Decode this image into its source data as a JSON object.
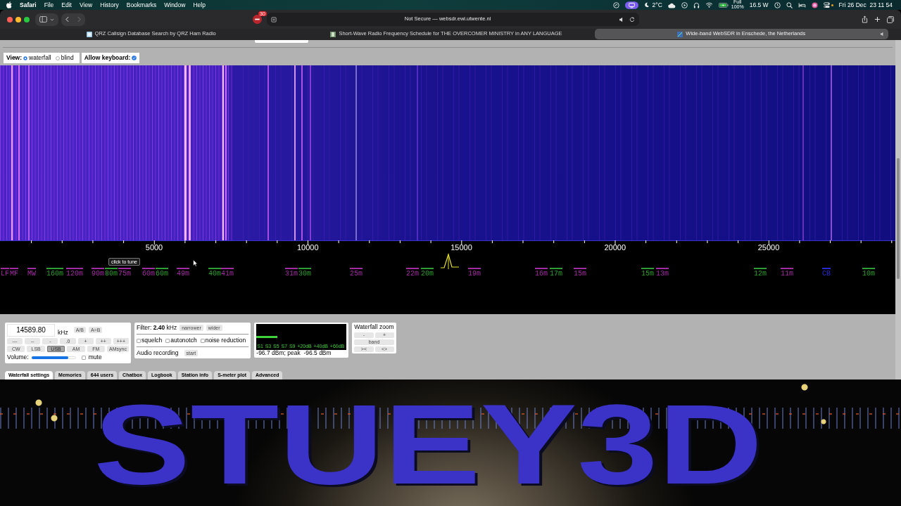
{
  "menu_bar": {
    "app": "Safari",
    "menus": [
      "File",
      "Edit",
      "View",
      "History",
      "Bookmarks",
      "Window",
      "Help"
    ],
    "temperature": "2°C",
    "battery_text": [
      "Full",
      "100%"
    ],
    "power": "16.5 W",
    "clock": "Fri 26 Dec  23 11 54"
  },
  "browser": {
    "extension_badge": "30",
    "address": "Not Secure — websdr.ewi.utwente.nl",
    "tabs": [
      {
        "title": "QRZ Callsign Database Search by QRZ Ham Radio",
        "selected": false,
        "audio": false
      },
      {
        "title": "Short-Wave Radio Frequency Schedule for THE OVERCOMER MINISTRY in ANY LANGUAGE",
        "selected": false,
        "audio": false
      },
      {
        "title": "Wide-band WebSDR in Enschede, the Netherlands",
        "selected": true,
        "audio": true
      }
    ]
  },
  "view_bar": {
    "label": "View:",
    "options": [
      {
        "label": "waterfall",
        "selected": true
      },
      {
        "label": "blind",
        "selected": false
      }
    ],
    "keyboard": {
      "label": "Allow keyboard:",
      "checked": true
    }
  },
  "frequency_scale": {
    "labels": [
      "5000",
      "10000",
      "15000",
      "20000",
      "25000"
    ],
    "tooltip": "click to tune",
    "bands": [
      {
        "label": "LF",
        "color": "#a12ca1"
      },
      {
        "label": "MF",
        "color": "#a12ca1"
      },
      {
        "label": "MW",
        "color": "#a12ca1"
      },
      {
        "label": "160m",
        "color": "#2f9f2f"
      },
      {
        "label": "120m",
        "color": "#a12ca1"
      },
      {
        "label": "90m",
        "color": "#a12ca1"
      },
      {
        "label": "80m",
        "color": "#2f9f2f"
      },
      {
        "label": "75m",
        "color": "#a12ca1"
      },
      {
        "label": "60m",
        "color": "#a12ca1"
      },
      {
        "label": "60m",
        "color": "#2f9f2f"
      },
      {
        "label": "49m",
        "color": "#a12ca1"
      },
      {
        "label": "40m",
        "color": "#2f9f2f"
      },
      {
        "label": "41m",
        "color": "#a12ca1"
      },
      {
        "label": "31m",
        "color": "#a12ca1"
      },
      {
        "label": "30m",
        "color": "#2f9f2f"
      },
      {
        "label": "25m",
        "color": "#a12ca1"
      },
      {
        "label": "22m",
        "color": "#a12ca1"
      },
      {
        "label": "20m",
        "color": "#2f9f2f"
      },
      {
        "label": "19m",
        "color": "#a12ca1"
      },
      {
        "label": "16m",
        "color": "#a12ca1"
      },
      {
        "label": "17m",
        "color": "#2f9f2f"
      },
      {
        "label": "15m",
        "color": "#a12ca1"
      },
      {
        "label": "15m",
        "color": "#2f9f2f"
      },
      {
        "label": "13m",
        "color": "#a12ca1"
      },
      {
        "label": "12m",
        "color": "#2f9f2f"
      },
      {
        "label": "11m",
        "color": "#a12ca1"
      },
      {
        "label": "CB",
        "color": "#2828d0"
      },
      {
        "label": "10m",
        "color": "#2f9f2f"
      }
    ]
  },
  "tuner": {
    "frequency": "14589.80",
    "unit": "kHz",
    "vfo_buttons": [
      "A/B",
      "A=B"
    ],
    "step_buttons": [
      "---",
      "--",
      "-",
      ".0",
      "+",
      "++",
      "+++"
    ],
    "modes": [
      {
        "label": "CW",
        "selected": false
      },
      {
        "label": "LSB",
        "selected": false
      },
      {
        "label": "USB",
        "selected": true
      },
      {
        "label": "AM",
        "selected": false
      },
      {
        "label": "FM",
        "selected": false
      },
      {
        "label": "AMsync",
        "selected": false
      }
    ],
    "volume": {
      "label": "Volume:",
      "level": 0.83
    },
    "mute": {
      "label": "mute",
      "checked": false
    }
  },
  "filter": {
    "text": "Filter: **2.40** kHz",
    "buttons": [
      "narrower",
      "wider"
    ],
    "options": [
      {
        "label": "squelch",
        "checked": false
      },
      {
        "label": "autonotch",
        "checked": false
      },
      {
        "label": "noise reduction",
        "checked": false
      }
    ],
    "recording_label": "Audio recording",
    "recording_button": "start"
  },
  "s_meter": {
    "level": 0.23,
    "scale": [
      "S1",
      "S3",
      "S5",
      "S7",
      "S9",
      "+20dB",
      "+40dB",
      "+60dB"
    ],
    "reading": "-96.7 dBm; peak  -96.5 dBm"
  },
  "waterfall_zoom": {
    "title": "Waterfall zoom",
    "buttons": [
      "-",
      "+",
      "band",
      "><",
      "<>"
    ]
  },
  "panel_tabs": [
    {
      "label": "Waterfall settings",
      "selected": true
    },
    {
      "label": "Memories",
      "selected": false
    },
    {
      "label": "644 users",
      "selected": false
    },
    {
      "label": "Chatbox",
      "selected": false
    },
    {
      "label": "Logbook",
      "selected": false
    },
    {
      "label": "Station info",
      "selected": false
    },
    {
      "label": "S-meter plot",
      "selected": false
    },
    {
      "label": "Advanced",
      "selected": false
    }
  ],
  "stream_overlay": {
    "logo": "STUEY3D"
  }
}
